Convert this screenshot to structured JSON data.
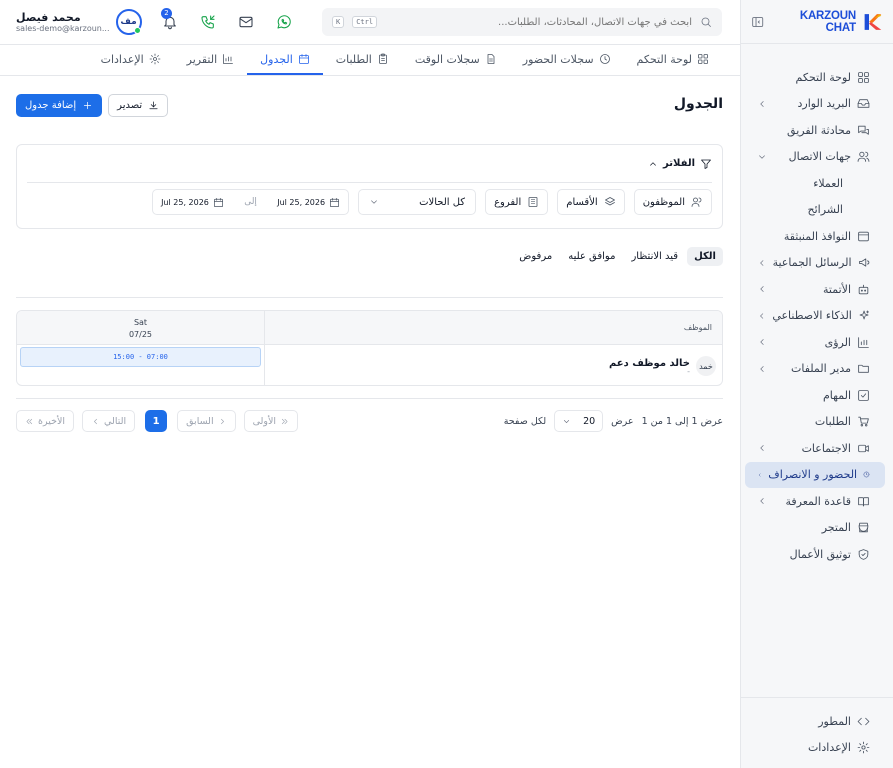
{
  "brand": {
    "name": "KARZOUN CHAT",
    "logo_icon": "karzoun-logo-icon",
    "accent": "#1d4ed8"
  },
  "sidebar": {
    "items": [
      {
        "label": "لوحة التحكم",
        "icon": "dashboard-icon"
      },
      {
        "label": "البريد الوارد",
        "icon": "inbox-icon",
        "expandable": true
      },
      {
        "label": "محادثة الفريق",
        "icon": "team-chat-icon"
      },
      {
        "label": "جهات الاتصال",
        "icon": "contacts-icon",
        "expanded": true
      },
      {
        "label": "العملاء",
        "sub": true
      },
      {
        "label": "الشرائح",
        "sub": true
      },
      {
        "label": "النوافذ المنبثقة",
        "icon": "popup-icon"
      },
      {
        "label": "الرسائل الجماعية",
        "icon": "megaphone-icon",
        "expandable": true
      },
      {
        "label": "الأتمتة",
        "icon": "bot-icon",
        "expandable": true
      },
      {
        "label": "الذكاء الاصطناعي",
        "icon": "sparkle-icon",
        "expandable": true
      },
      {
        "label": "الرؤى",
        "icon": "bar-chart-icon",
        "expandable": true
      },
      {
        "label": "مدير الملفات",
        "icon": "folder-icon",
        "expandable": true
      },
      {
        "label": "المهام",
        "icon": "task-icon"
      },
      {
        "label": "الطلبات",
        "icon": "cart-icon"
      },
      {
        "label": "الاجتماعات",
        "icon": "video-icon",
        "expandable": true
      },
      {
        "label": "الحضور و الانصراف",
        "icon": "clock-icon",
        "expandable": true,
        "active": true
      },
      {
        "label": "قاعدة المعرفة",
        "icon": "book-icon",
        "expandable": true
      },
      {
        "label": "المتجر",
        "icon": "store-icon"
      },
      {
        "label": "توثيق الأعمال",
        "icon": "shield-check-icon"
      }
    ],
    "bottom": [
      {
        "label": "المطور",
        "icon": "code-icon"
      },
      {
        "label": "الإعدادات",
        "icon": "gear-icon"
      }
    ]
  },
  "topbar": {
    "search_placeholder": "ابحث في جهات الاتصال، المحادثات، الطلبات...",
    "shortcut_ctrl": "Ctrl",
    "shortcut_key": "K",
    "notification_count": "2",
    "user": {
      "name": "محمد فيصل",
      "email": "sales-demo@karzoun...",
      "initials": "مف"
    }
  },
  "tabs": [
    {
      "label": "لوحة التحكم",
      "icon": "grid-icon"
    },
    {
      "label": "سجلات الحضور",
      "icon": "clock-icon"
    },
    {
      "label": "سجلات الوقت",
      "icon": "file-icon"
    },
    {
      "label": "الطلبات",
      "icon": "clipboard-icon"
    },
    {
      "label": "الجدول",
      "icon": "calendar-icon",
      "active": true
    },
    {
      "label": "التقرير",
      "icon": "report-icon"
    },
    {
      "label": "الإعدادات",
      "icon": "gear-icon"
    }
  ],
  "page": {
    "title": "الجدول",
    "add_label": "إضافة جدول",
    "export_label": "تصدير"
  },
  "filters": {
    "title": "الفلاتر",
    "employees": "الموظفون",
    "departments": "الأقسام",
    "branches": "الفروع",
    "status_value": "كل الحالات",
    "date_from": "Jul 25, 2026",
    "to_label": "إلى",
    "date_to": "Jul 25, 2026"
  },
  "status_tabs": [
    "الكل",
    "قيد الانتظار",
    "موافق عليه",
    "مرفوض"
  ],
  "schedule": {
    "employee_header": "الموظف",
    "days": [
      {
        "dow": "Sat",
        "date": "07/25"
      }
    ],
    "rows": [
      {
        "initials": "خمد",
        "name": "خالد موظف دعم",
        "sub": "-",
        "shifts": [
          "15:00 - 07:00"
        ]
      }
    ]
  },
  "pagination": {
    "info": "عرض 1 إلى 1 من 1",
    "show_label": "عرض",
    "per_page": "20",
    "per_page_suffix": "لكل صفحة",
    "first": "الأولى",
    "prev": "السابق",
    "page": "1",
    "next": "التالي",
    "last": "الأخيرة"
  },
  "colors": {
    "primary": "#1d6ee8",
    "whatsapp": "#16a34a",
    "active_nav": "#dbe4f3"
  }
}
